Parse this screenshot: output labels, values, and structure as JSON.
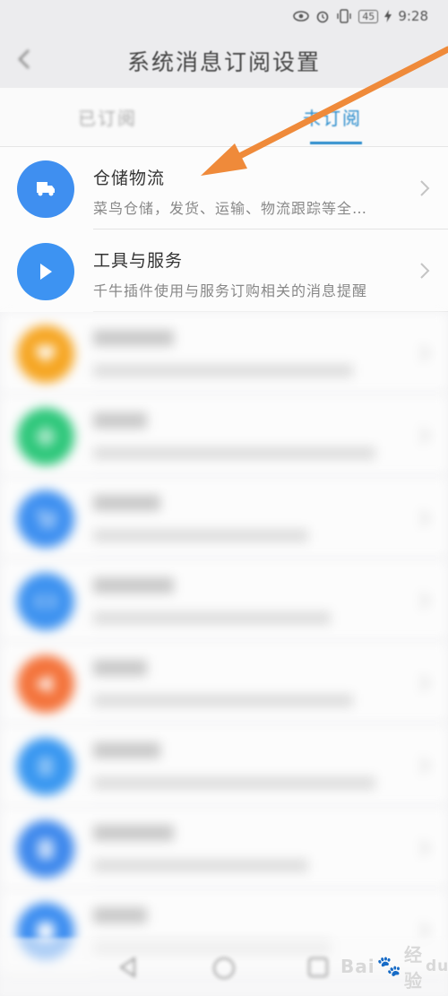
{
  "status_bar": {
    "carrier": "",
    "battery": "45",
    "time": "9:28"
  },
  "header": {
    "title": "系统消息订阅设置"
  },
  "tabs": [
    {
      "label": "已订阅",
      "active": false
    },
    {
      "label": "未订阅",
      "active": true
    }
  ],
  "items": [
    {
      "title": "仓储物流",
      "subtitle": "菜鸟仓储，发货、运输、物流跟踪等全…",
      "icon": "truck-icon",
      "color": "#3f8ff0",
      "blur": 0
    },
    {
      "title": "工具与服务",
      "subtitle": "千牛插件使用与服务订购相关的消息提醒",
      "icon": "play-icon",
      "color": "#3d93f2",
      "blur": 0
    },
    {
      "title": "",
      "subtitle": "",
      "icon": "heart-icon",
      "color": "#f6a623",
      "blur": 1
    },
    {
      "title": "",
      "subtitle": "",
      "icon": "diamond-icon",
      "color": "#2dc77a",
      "blur": 1
    },
    {
      "title": "",
      "subtitle": "",
      "icon": "cart-icon",
      "color": "#3d8ff0",
      "blur": 1
    },
    {
      "title": "",
      "subtitle": "",
      "icon": "code-icon",
      "color": "#3d92f0",
      "blur": 1
    },
    {
      "title": "",
      "subtitle": "",
      "icon": "megaphone-icon",
      "color": "#f4733b",
      "blur": 1
    },
    {
      "title": "",
      "subtitle": "",
      "icon": "list-icon",
      "color": "#3796f0",
      "blur": 1
    },
    {
      "title": "",
      "subtitle": "",
      "icon": "document-icon",
      "color": "#3c87ec",
      "blur": 1
    },
    {
      "title": "",
      "subtitle": "",
      "icon": "store-icon",
      "color": "#3a8cf0",
      "blur": 1
    }
  ],
  "watermark": {
    "text_a": "Bai",
    "text_b": "经验",
    "text_sub": "du"
  },
  "colors": {
    "accent": "#2a8ccc",
    "arrow": "#ef8a3a"
  }
}
